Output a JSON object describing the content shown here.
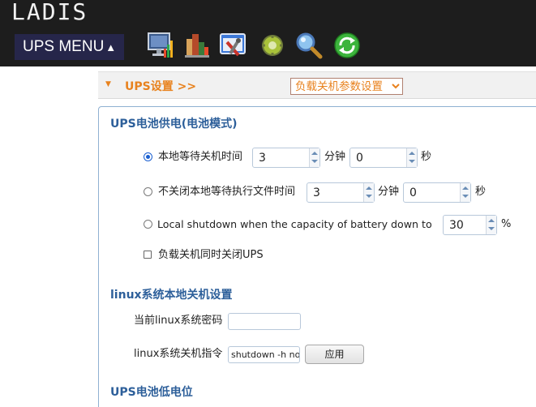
{
  "header": {
    "logo": "LADIS",
    "menu_label": "UPS MENU",
    "menu_arrow": "▲",
    "toolbar_icons": [
      "monitor-chart-icon",
      "status-bars-icon",
      "configuration-tools-icon",
      "gear-icon",
      "search-icon",
      "refresh-icon"
    ]
  },
  "breadcrumb": {
    "path": "UPS设置 >>",
    "selected": "负载关机参数设置"
  },
  "battery_section": {
    "title": "UPS电池供电(电池模式)",
    "option1": {
      "label": "本地等待关机时间",
      "minutes": "3",
      "min_unit": "分钟",
      "seconds": "0",
      "sec_unit": "秒",
      "checked": true
    },
    "option2": {
      "label": "不关闭本地等待执行文件时间",
      "minutes": "3",
      "min_unit": "分钟",
      "seconds": "0",
      "sec_unit": "秒",
      "checked": false
    },
    "option3": {
      "label": "Local shutdown when the capacity of battery down to",
      "value": "30",
      "unit": "%",
      "checked": false
    },
    "checkbox": {
      "label": "负载关机同时关闭UPS",
      "checked": false
    }
  },
  "linux_section": {
    "title": "linux系统本地关机设置",
    "password_label": "当前linux系统密码",
    "password_value": "",
    "command_label": "linux系统关机指令",
    "command_value": "shutdown -h now",
    "apply_button": "应用"
  },
  "low_battery_section": {
    "title": "UPS电池低电位"
  },
  "colors": {
    "header_bg": "#1d1d1d",
    "menu_bg": "#26264a",
    "accent_orange": "#e8821e",
    "section_blue": "#2d5f9a"
  }
}
